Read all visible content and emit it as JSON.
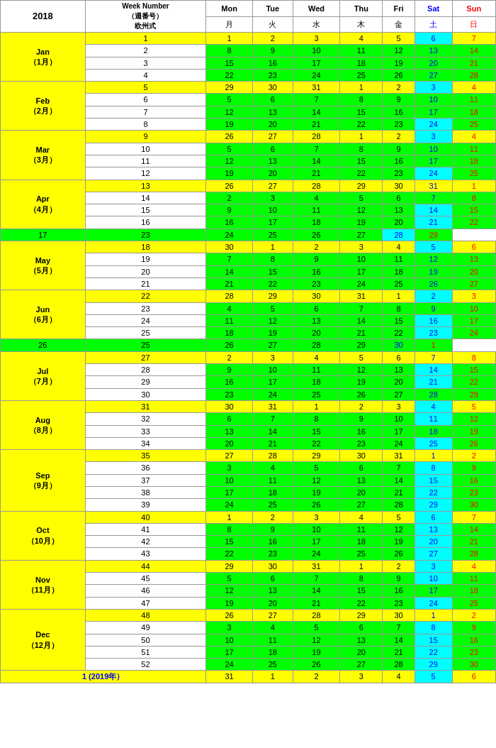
{
  "header": {
    "year": "2018",
    "week_number_label": "Week Number",
    "week_number_jp": "（週番号）",
    "european": "欧州式",
    "days": {
      "mon": "Mon",
      "tue": "Tue",
      "wed": "Wed",
      "thu": "Thu",
      "fri": "Fri",
      "sat": "Sat",
      "sun": "Sun"
    },
    "days_jp": {
      "mon": "月",
      "tue": "火",
      "wed": "水",
      "thu": "木",
      "fri": "金",
      "sat": "土",
      "sun": "日"
    }
  },
  "months": {
    "jan": "Jan\n（1月）",
    "feb": "Feb\n（2月）",
    "mar": "Mar\n（3月）",
    "apr": "Apr\n（4月）",
    "may": "May\n（5月）",
    "jun": "Jun\n（6月）",
    "jul": "Jul\n（7月）",
    "aug": "Aug\n（8月）",
    "sep": "Sep\n（9月）",
    "oct": "Oct\n（10月）",
    "nov": "Nov\n（11月）",
    "dec": "Dec\n（12月）"
  },
  "last_row_week": "1 (2019年）"
}
